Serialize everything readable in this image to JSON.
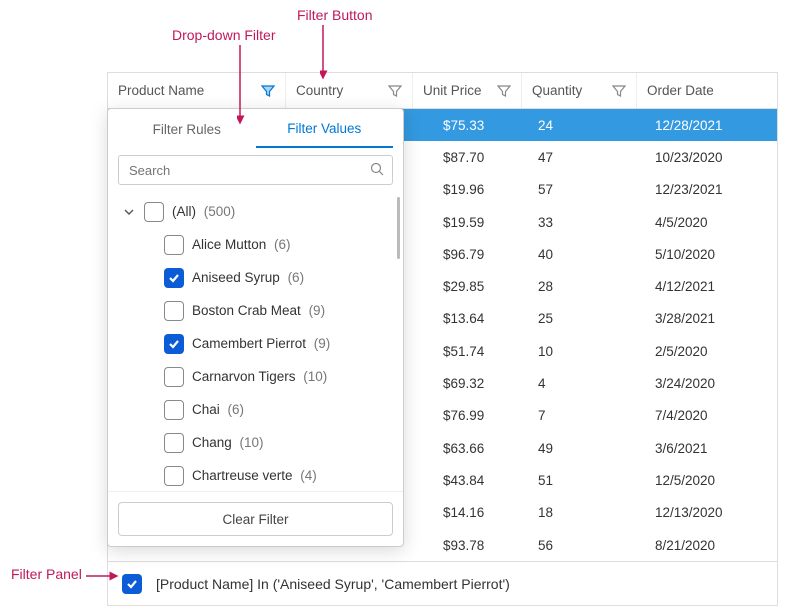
{
  "annotations": {
    "filter_button": "Filter Button",
    "dropdown_filter": "Drop-down Filter",
    "filter_panel": "Filter Panel"
  },
  "columns": {
    "product": "Product Name",
    "country": "Country",
    "price": "Unit Price",
    "qty": "Quantity",
    "date": "Order Date"
  },
  "popup": {
    "tab_rules": "Filter Rules",
    "tab_values": "Filter Values",
    "search_placeholder": "Search",
    "all_label": "(All)",
    "all_count": "(500)",
    "items": [
      {
        "label": "Alice Mutton",
        "count": "(6)",
        "checked": false
      },
      {
        "label": "Aniseed Syrup",
        "count": "(6)",
        "checked": true
      },
      {
        "label": "Boston Crab Meat",
        "count": "(9)",
        "checked": false
      },
      {
        "label": "Camembert Pierrot",
        "count": "(9)",
        "checked": true
      },
      {
        "label": "Carnarvon Tigers",
        "count": "(10)",
        "checked": false
      },
      {
        "label": "Chai",
        "count": "(6)",
        "checked": false
      },
      {
        "label": "Chang",
        "count": "(10)",
        "checked": false
      },
      {
        "label": "Chartreuse verte",
        "count": "(4)",
        "checked": false
      }
    ],
    "clear": "Clear Filter"
  },
  "rows": [
    {
      "price": "$75.33",
      "qty": "24",
      "date": "12/28/2021",
      "selected": true
    },
    {
      "price": "$87.70",
      "qty": "47",
      "date": "10/23/2020"
    },
    {
      "price": "$19.96",
      "qty": "57",
      "date": "12/23/2021"
    },
    {
      "price": "$19.59",
      "qty": "33",
      "date": "4/5/2020"
    },
    {
      "price": "$96.79",
      "qty": "40",
      "date": "5/10/2020"
    },
    {
      "price": "$29.85",
      "qty": "28",
      "date": "4/12/2021"
    },
    {
      "price": "$13.64",
      "qty": "25",
      "date": "3/28/2021"
    },
    {
      "price": "$51.74",
      "qty": "10",
      "date": "2/5/2020"
    },
    {
      "price": "$69.32",
      "qty": "4",
      "date": "3/24/2020"
    },
    {
      "price": "$76.99",
      "qty": "7",
      "date": "7/4/2020"
    },
    {
      "price": "$63.66",
      "qty": "49",
      "date": "3/6/2021"
    },
    {
      "price": "$43.84",
      "qty": "51",
      "date": "12/5/2020"
    },
    {
      "price": "$14.16",
      "qty": "18",
      "date": "12/13/2020"
    },
    {
      "price": "$93.78",
      "qty": "56",
      "date": "8/21/2020"
    }
  ],
  "filter_panel": {
    "expression": "[Product Name] In ('Aniseed Syrup', 'Camembert Pierrot')"
  }
}
